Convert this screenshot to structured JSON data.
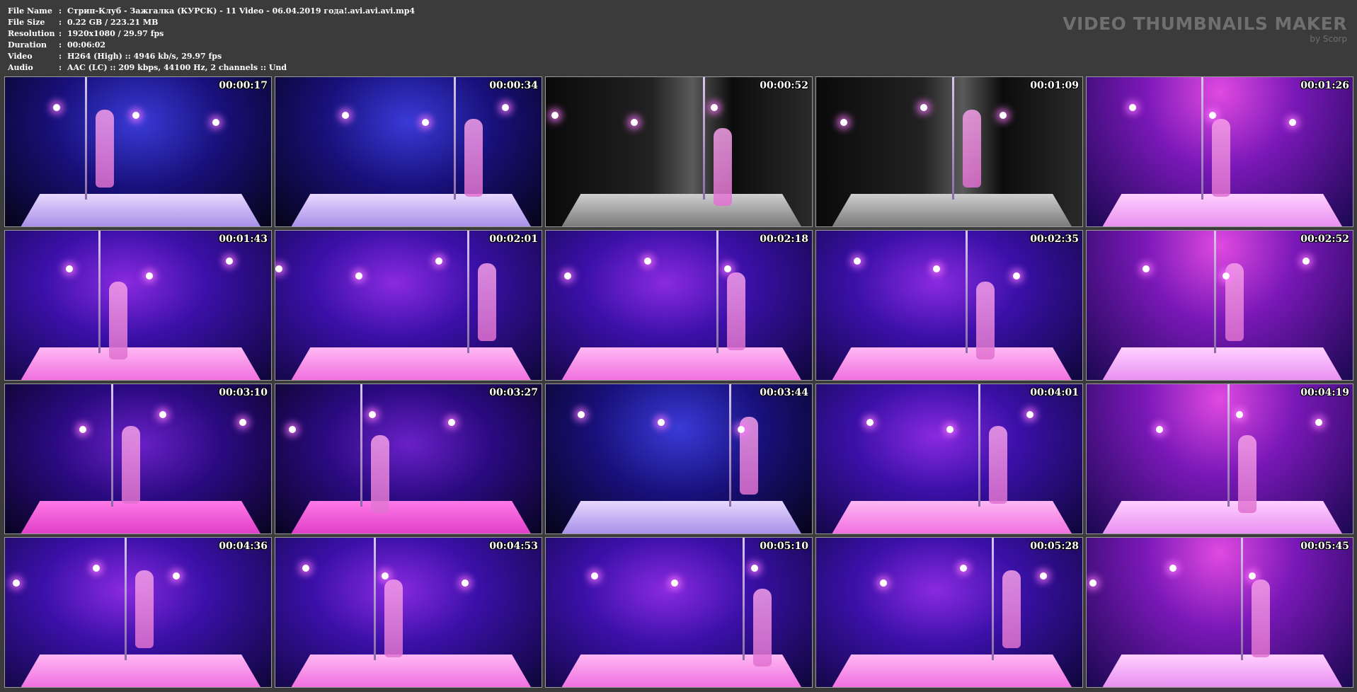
{
  "info": {
    "rows": [
      {
        "label": "File Name",
        "value": "Стрип-Клуб - Зажгалка (КУРСК) - 11 Video - 06.04.2019 года!.avi.avi.avi.mp4"
      },
      {
        "label": "File Size",
        "value": "0.22 GB  / 223.21 MB"
      },
      {
        "label": "Resolution",
        "value": "1920x1080 / 29.97 fps"
      },
      {
        "label": "Duration",
        "value": "00:06:02"
      },
      {
        "label": "Video",
        "value": "H264 (High) :: 4946 kb/s, 29.97 fps"
      },
      {
        "label": "Audio",
        "value": "AAC (LC) :: 209 kbps, 44100 Hz, 2 channels :: Und"
      }
    ],
    "separator": ":"
  },
  "brand": {
    "title": "VIDEO THUMBNAILS MAKER",
    "subtitle": "by Scorp"
  },
  "thumbnails": [
    {
      "time": "00:00:17",
      "palette": "blue"
    },
    {
      "time": "00:00:34",
      "palette": "blue"
    },
    {
      "time": "00:00:52",
      "palette": "dark"
    },
    {
      "time": "00:01:09",
      "palette": "dark"
    },
    {
      "time": "00:01:26",
      "palette": "pink"
    },
    {
      "time": "00:01:43",
      "palette": "purple"
    },
    {
      "time": "00:02:01",
      "palette": "purple"
    },
    {
      "time": "00:02:18",
      "palette": "purple"
    },
    {
      "time": "00:02:35",
      "palette": "purple"
    },
    {
      "time": "00:02:52",
      "palette": "pink"
    },
    {
      "time": "00:03:10",
      "palette": "magenta"
    },
    {
      "time": "00:03:27",
      "palette": "magenta"
    },
    {
      "time": "00:03:44",
      "palette": "blue"
    },
    {
      "time": "00:04:01",
      "palette": "purple"
    },
    {
      "time": "00:04:19",
      "palette": "pink"
    },
    {
      "time": "00:04:36",
      "palette": "purple"
    },
    {
      "time": "00:04:53",
      "palette": "purple"
    },
    {
      "time": "00:05:10",
      "palette": "purple"
    },
    {
      "time": "00:05:28",
      "palette": "purple"
    },
    {
      "time": "00:05:45",
      "palette": "pink"
    }
  ],
  "colors": {
    "background": "#3b3b3b",
    "text": "#ffffff",
    "brand": "#6f6f6f"
  }
}
